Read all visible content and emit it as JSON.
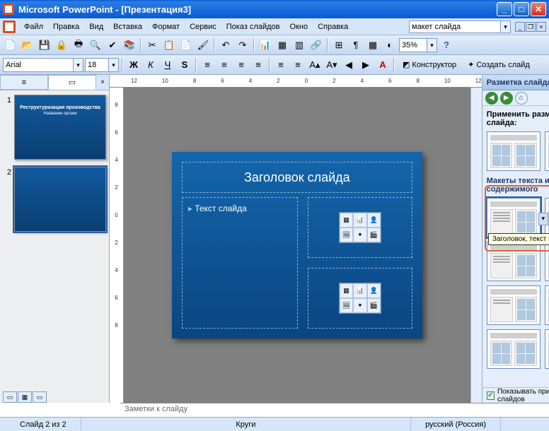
{
  "titlebar": {
    "app": "Microsoft PowerPoint",
    "doc": "[Презентация3]"
  },
  "menu": {
    "file": "Файл",
    "edit": "Правка",
    "view": "Вид",
    "insert": "Вставка",
    "format": "Формат",
    "tools": "Сервис",
    "slideshow": "Показ слайдов",
    "window": "Окно",
    "help": "Справка"
  },
  "helpbox_value": "макет слайда",
  "zoom": "35%",
  "font": {
    "name": "Arial",
    "size": "18"
  },
  "formatting": {
    "bold": "Ж",
    "italic": "К",
    "underline": "Ч",
    "shadow": "S",
    "designer": "Конструктор",
    "new_slide": "Создать слайд"
  },
  "ruler_h": [
    "12",
    "10",
    "8",
    "6",
    "4",
    "2",
    "0",
    "2",
    "4",
    "6",
    "8",
    "10",
    "12"
  ],
  "ruler_v": [
    "8",
    "6",
    "4",
    "2",
    "0",
    "2",
    "4",
    "6",
    "8"
  ],
  "thumbs": [
    {
      "num": "1",
      "title": "Реструктуризация производства",
      "sub": "Название органи"
    },
    {
      "num": "2",
      "title": "",
      "sub": ""
    }
  ],
  "slide": {
    "title": "Заголовок слайда",
    "text": "Текст слайда"
  },
  "taskpane": {
    "title": "Разметка слайда",
    "apply_label": "Применить разметку слайда:",
    "section": "Макеты текста и содержимого",
    "tooltip": "Заголовок, текст и объект",
    "callout": "?",
    "show_on_insert": "Показывать при вставке слайдов"
  },
  "notes_placeholder": "Заметки к слайду",
  "status": {
    "slide": "Слайд 2 из 2",
    "template": "Круги",
    "lang": "русский (Россия)"
  }
}
